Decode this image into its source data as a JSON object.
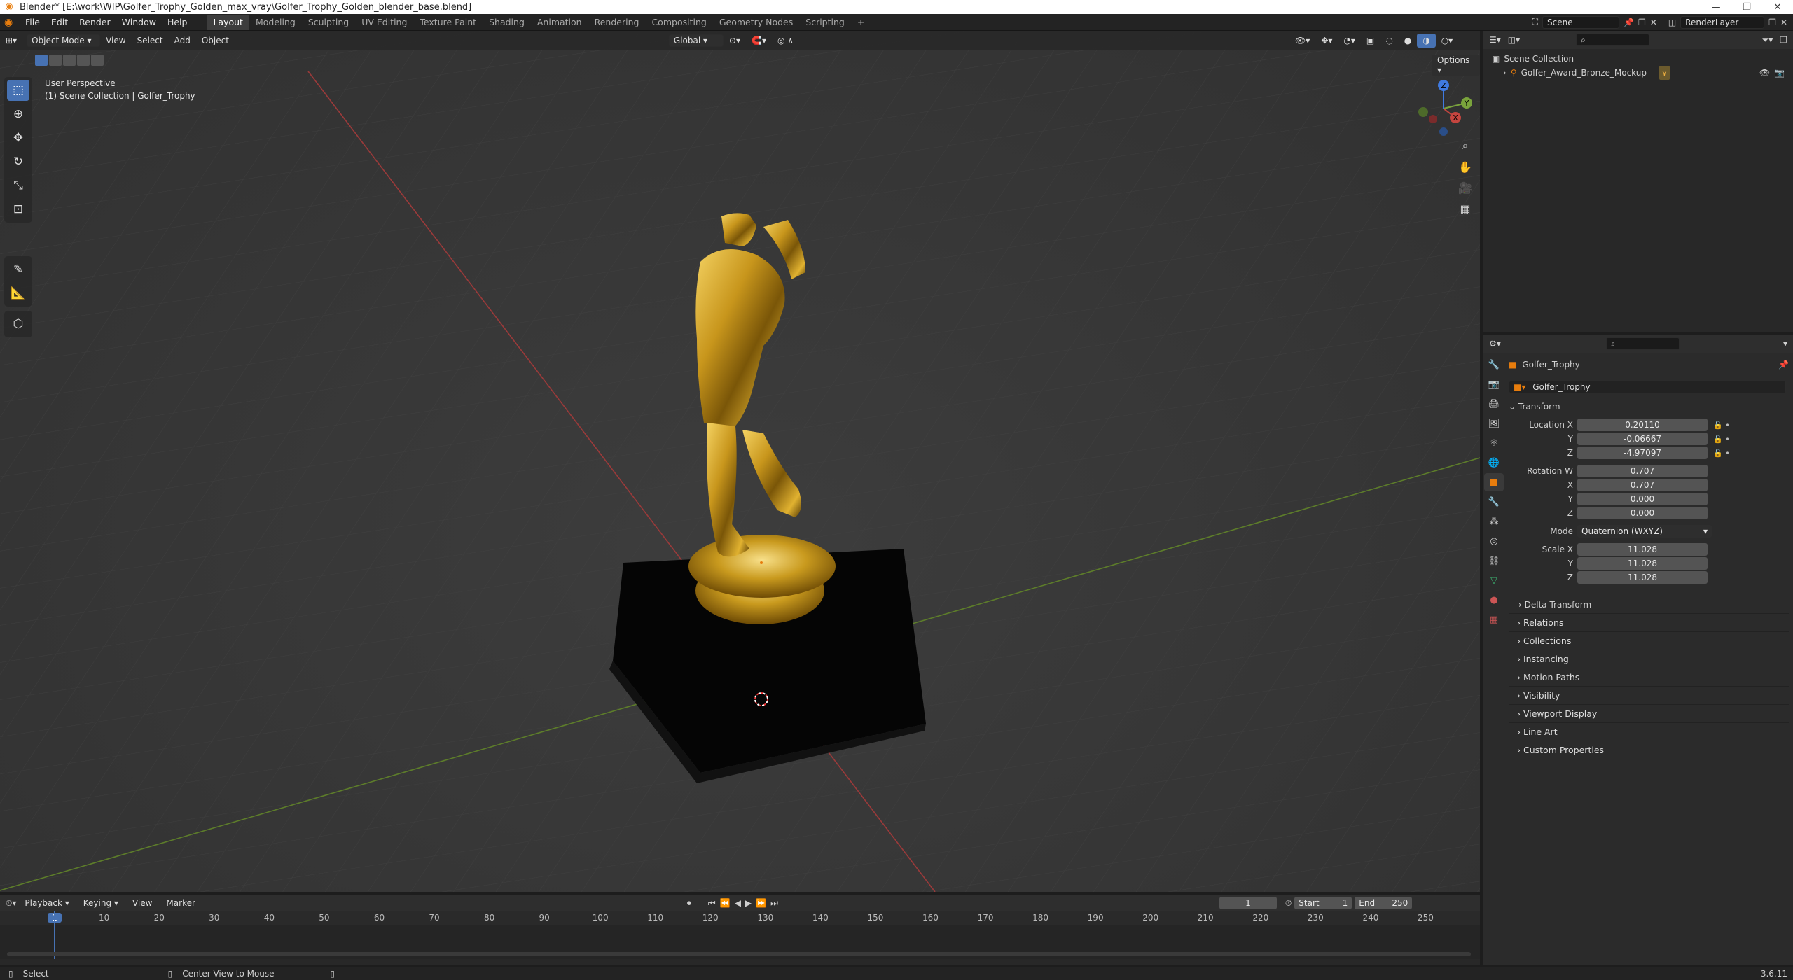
{
  "window_title": "Blender* [E:\\work\\WIP\\Golfer_Trophy_Golden_max_vray\\Golfer_Trophy_Golden_blender_base.blend]",
  "window_controls": [
    "—",
    "❐",
    "✕"
  ],
  "menu": [
    "File",
    "Edit",
    "Render",
    "Window",
    "Help"
  ],
  "workspaces": [
    "Layout",
    "Modeling",
    "Sculpting",
    "UV Editing",
    "Texture Paint",
    "Shading",
    "Animation",
    "Rendering",
    "Compositing",
    "Geometry Nodes",
    "Scripting"
  ],
  "active_workspace": "Layout",
  "scene_name": "Scene",
  "view_layer": "RenderLayer",
  "viewport": {
    "mode": "Object Mode",
    "menus": [
      "View",
      "Select",
      "Add",
      "Object"
    ],
    "orientation": "Global",
    "options_label": "Options",
    "overlay_text_1": "User Perspective",
    "overlay_text_2": "(1) Scene Collection | Golfer_Trophy",
    "gizmo_axes": {
      "x": "X",
      "y": "Y",
      "z": "Z"
    }
  },
  "outliner": {
    "root": "Scene Collection",
    "items": [
      {
        "name": "Golfer_Award_Bronze_Mockup"
      }
    ]
  },
  "properties": {
    "object_name": "Golfer_Trophy",
    "data_name": "Golfer_Trophy",
    "transform_label": "Transform",
    "location": {
      "label": "Location X",
      "x": "0.20110",
      "y": "-0.06667",
      "z": "-4.97097"
    },
    "rotation": {
      "label": "Rotation W",
      "w": "0.707",
      "x": "0.707",
      "y": "0.000",
      "z": "0.000"
    },
    "mode_label": "Mode",
    "mode_value": "Quaternion (WXYZ)",
    "scale": {
      "label": "Scale X",
      "x": "11.028",
      "y": "11.028",
      "z": "11.028"
    },
    "axis_labels": {
      "y": "Y",
      "z": "Z",
      "x": "X"
    },
    "delta_transform": "Delta Transform",
    "panels": [
      "Relations",
      "Collections",
      "Instancing",
      "Motion Paths",
      "Visibility",
      "Viewport Display",
      "Line Art",
      "Custom Properties"
    ]
  },
  "timeline": {
    "menus": [
      "Playback",
      "Keying",
      "View",
      "Marker"
    ],
    "current_frame": "1",
    "start_label": "Start",
    "start": "1",
    "end_label": "End",
    "end": "250",
    "ticks": [
      "1",
      "10",
      "20",
      "30",
      "40",
      "50",
      "60",
      "70",
      "80",
      "90",
      "100",
      "110",
      "120",
      "130",
      "140",
      "150",
      "160",
      "170",
      "180",
      "190",
      "200",
      "210",
      "220",
      "230",
      "240",
      "250"
    ]
  },
  "statusbar": {
    "select": "Select",
    "center": "Center View to Mouse",
    "version": "3.6.11"
  },
  "colors": {
    "accent": "#4772b3",
    "x_axis": "#c4453f",
    "y_axis": "#7aa33c",
    "z_axis": "#3f7ae0",
    "gold": "#c89a1e",
    "object_orange": "#e87d0d"
  }
}
